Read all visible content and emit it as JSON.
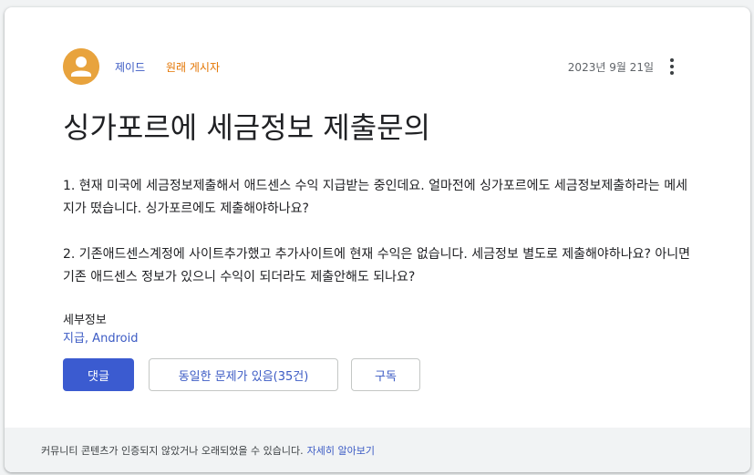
{
  "post": {
    "author": "제이드",
    "author_tag": "원래 게시자",
    "date": "2023년 9월 21일",
    "title": "싱가포르에 세금정보 제출문의",
    "paragraphs": [
      "1. 현재 미국에 세금정보제출해서 애드센스 수익 지급받는 중인데요. 얼마전에 싱가포르에도 세금정보제출하라는 메세지가 떴습니다. 싱가포르에도 제출해야하나요?",
      "2. 기존애드센스계정에 사이트추가했고 추가사이트에 현재 수익은 없습니다. 세금정보 별도로 제출해야하나요? 아니면 기존 애드센스 정보가 있으니 수익이 되더라도 제출안해도 되나요?"
    ],
    "details_label": "세부정보",
    "details_value": "지급, Android"
  },
  "actions": {
    "reply_label": "댓글",
    "same_issue_label": "동일한 문제가 있음(35건)",
    "subscribe_label": "구독"
  },
  "icons": {
    "avatar": "person-icon",
    "more": "more-vert-icon"
  },
  "footer": {
    "notice": "커뮤니티 콘텐츠가 인증되지 않았거나 오래되었을 수 있습니다.",
    "link": "자세히 알아보기"
  },
  "colors": {
    "accent": "#3b5bd0",
    "avatar_bg": "#e8a33d",
    "author_tag": "#e37400"
  }
}
